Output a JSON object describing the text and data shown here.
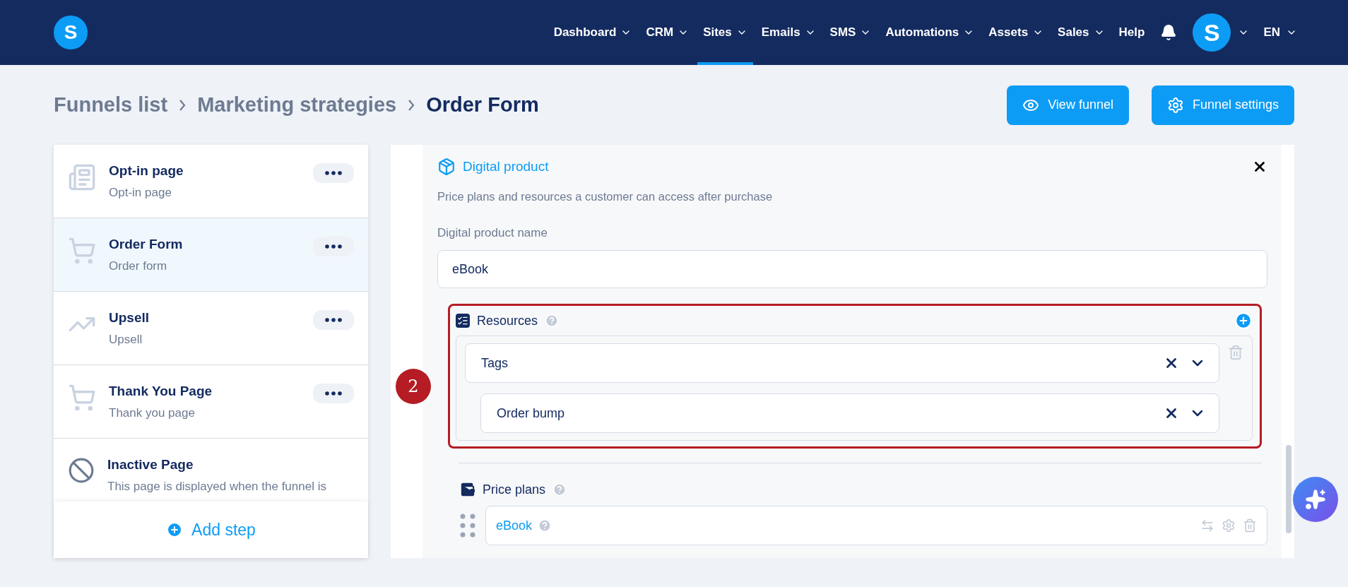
{
  "nav": {
    "logo": "S",
    "items": [
      {
        "label": "Dashboard",
        "selected": false,
        "dropdown": true
      },
      {
        "label": "CRM",
        "selected": false,
        "dropdown": true
      },
      {
        "label": "Sites",
        "selected": true,
        "dropdown": true
      },
      {
        "label": "Emails",
        "selected": false,
        "dropdown": true
      },
      {
        "label": "SMS",
        "selected": false,
        "dropdown": true
      },
      {
        "label": "Automations",
        "selected": false,
        "dropdown": true
      },
      {
        "label": "Assets",
        "selected": false,
        "dropdown": true
      },
      {
        "label": "Sales",
        "selected": false,
        "dropdown": true
      },
      {
        "label": "Help",
        "selected": false,
        "dropdown": false
      }
    ],
    "avatar": "S",
    "language": "EN"
  },
  "breadcrumb": [
    "Funnels list",
    "Marketing strategies",
    "Order Form"
  ],
  "actions": [
    {
      "label": "View funnel",
      "kind": "view"
    },
    {
      "label": "Funnel settings",
      "kind": "settings"
    }
  ],
  "steps": [
    {
      "kind": "optin",
      "title": "Opt-in page",
      "subtitle": "Opt-in page",
      "selected": false
    },
    {
      "kind": "order",
      "title": "Order Form",
      "subtitle": "Order form",
      "selected": true
    },
    {
      "kind": "upsell",
      "title": "Upsell",
      "subtitle": "Upsell",
      "selected": false
    },
    {
      "kind": "thankyou",
      "title": "Thank You Page",
      "subtitle": "Thank you page",
      "selected": false
    },
    {
      "kind": "inactive",
      "title": "Inactive Page",
      "subtitle": "This page is displayed when the funnel is",
      "selected": false
    }
  ],
  "add_step": "Add step",
  "product": {
    "title": "Digital product",
    "description": "Price plans and resources a customer can access after purchase",
    "name_label": "Digital product name",
    "name_value": "eBook",
    "resources": {
      "title": "Resources",
      "selects": [
        {
          "value": "Tags"
        },
        {
          "value": "Order bump"
        }
      ]
    },
    "price_plans": {
      "title": "Price plans",
      "items": [
        {
          "name": "eBook"
        }
      ]
    }
  },
  "annotation": "2"
}
